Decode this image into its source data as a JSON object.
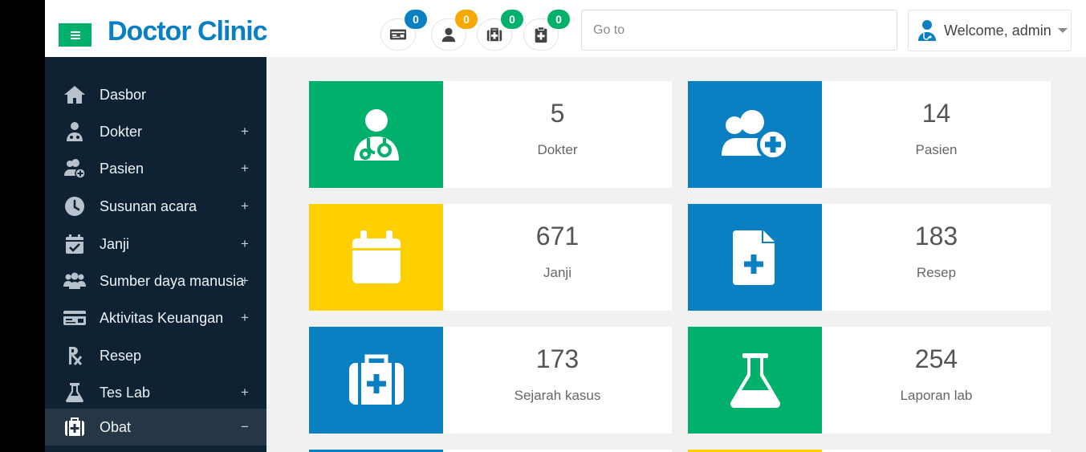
{
  "header": {
    "brand": "Doctor Clinic",
    "notifications": [
      {
        "icon": "money-bill-icon",
        "count": "0",
        "color": "#0a7fc2"
      },
      {
        "icon": "user-icon",
        "count": "0",
        "color": "#f5a800"
      },
      {
        "icon": "medkit-icon",
        "count": "0",
        "color": "#00b06b"
      },
      {
        "icon": "clipboard-plus-icon",
        "count": "0",
        "color": "#00b06b"
      }
    ],
    "goto_placeholder": "Go to",
    "welcome": "Welcome, admin"
  },
  "sidebar": {
    "items": [
      {
        "label": "Dasbor",
        "icon": "home-icon",
        "sign": ""
      },
      {
        "label": "Dokter",
        "icon": "user-doctor-icon",
        "sign": "+"
      },
      {
        "label": "Pasien",
        "icon": "user-plus-icon",
        "sign": "+"
      },
      {
        "label": "Susunan acara",
        "icon": "clock-icon",
        "sign": "+"
      },
      {
        "label": "Janji",
        "icon": "calendar-check-icon",
        "sign": "+"
      },
      {
        "label": "Sumber daya manusia",
        "icon": "users-icon",
        "sign": "+"
      },
      {
        "label": "Aktivitas Keuangan",
        "icon": "money-bill-icon",
        "sign": "+"
      },
      {
        "label": "Resep",
        "icon": "prescription-icon",
        "sign": ""
      },
      {
        "label": "Tes Lab",
        "icon": "flask-icon",
        "sign": "+"
      },
      {
        "label": "Obat",
        "icon": "medkit-icon",
        "sign": "−",
        "active": true
      }
    ]
  },
  "cards": [
    {
      "value": "5",
      "label": "Dokter",
      "icon": "user-doctor-icon",
      "color": "#00b06b"
    },
    {
      "value": "14",
      "label": "Pasien",
      "icon": "user-plus-icon",
      "color": "#0a7fc2"
    },
    {
      "value": "671",
      "label": "Janji",
      "icon": "calendar-icon",
      "color": "#ffd000"
    },
    {
      "value": "183",
      "label": "Resep",
      "icon": "file-medical-icon",
      "color": "#0a7fc2"
    },
    {
      "value": "173",
      "label": "Sejarah kasus",
      "icon": "medkit-icon",
      "color": "#0a7fc2"
    },
    {
      "value": "254",
      "label": "Laporan lab",
      "icon": "flask-icon",
      "color": "#00b06b"
    }
  ],
  "colors": {
    "sidebar_bg": "#0e2234",
    "sidebar_active": "#253646",
    "brand": "#0a7fc2",
    "green": "#00b06b",
    "blue": "#0a7fc2",
    "yellow": "#ffd000",
    "orange": "#f5a800"
  }
}
